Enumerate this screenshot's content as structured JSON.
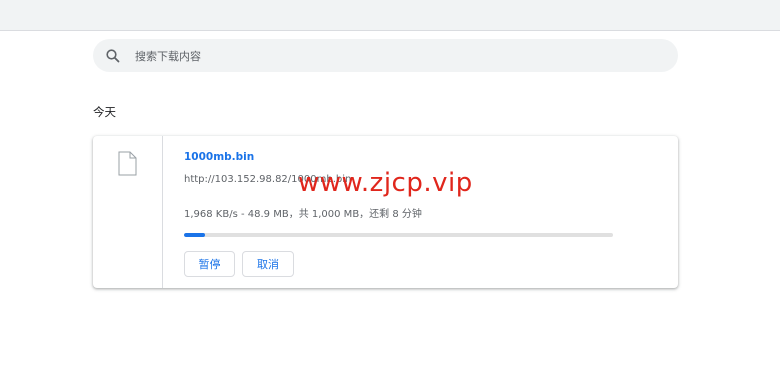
{
  "search": {
    "placeholder": "搜索下载内容",
    "value": ""
  },
  "section": {
    "title": "今天"
  },
  "download": {
    "file_name": "1000mb.bin",
    "url": "http://103.152.98.82/1000mb.bin",
    "status": "1,968 KB/s - 48.9 MB，共 1,000 MB，还剩 8 分钟",
    "progress_fraction": 0.049,
    "pause_label": "暂停",
    "cancel_label": "取消"
  },
  "watermark": {
    "text": "www.zjcp.vip"
  },
  "colors": {
    "accent": "#1a73e8",
    "watermark": "#e0261c"
  },
  "icons": {
    "search": "search-icon",
    "file": "file-icon"
  }
}
